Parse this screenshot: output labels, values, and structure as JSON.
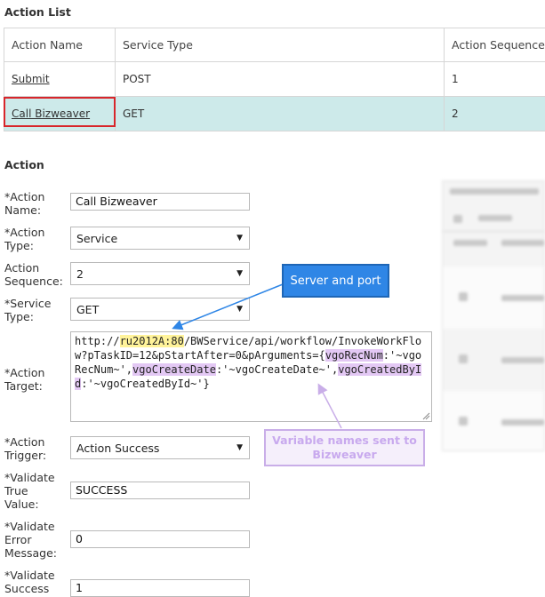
{
  "action_list": {
    "title": "Action List",
    "columns": [
      "Action Name",
      "Service Type",
      "Action Sequence"
    ],
    "rows": [
      {
        "name": "Submit",
        "service_type": "POST",
        "sequence": "1"
      },
      {
        "name": "Call Bizweaver",
        "service_type": "GET",
        "sequence": "2"
      }
    ]
  },
  "action": {
    "title": "Action",
    "fields": {
      "name": {
        "label_line1": "*Action",
        "label_line2": "Name:",
        "value": "Call Bizweaver"
      },
      "type": {
        "label_line1": "*Action",
        "label_line2": "Type:",
        "value": "Service"
      },
      "sequence": {
        "label_line1": "Action",
        "label_line2": "Sequence:",
        "value": "2"
      },
      "service_type": {
        "label_line1": "*Service",
        "label_line2": "Type:",
        "value": "GET"
      },
      "target": {
        "label_line1": "*Action",
        "label_line2": "Target:",
        "parts": {
          "prefix": "http://",
          "server_port": "ru2012A:80",
          "path": "/BWService/api/workflow/InvokeWorkFlow?pTaskID=12&pStartAfter=0&pArguments={",
          "var1": "vgoRecNum",
          "mid1": ":'~vgoRecNum~',",
          "var2": "vgoCreateDate",
          "mid2": ":'~vgoCreateDate~',",
          "var3": "vgoCreatedById",
          "suffix": ":'~vgoCreatedById~'}"
        }
      },
      "trigger": {
        "label_line1": "*Action",
        "label_line2": "Trigger:",
        "value": "Action Success"
      },
      "validate_true": {
        "label_line1": "*Validate",
        "label_line2": "True",
        "label_line3": "Value:",
        "value": "SUCCESS"
      },
      "validate_error": {
        "label_line1": "*Validate",
        "label_line2": "Error",
        "label_line3": "Message:",
        "value": "0"
      },
      "validate_success": {
        "label_line1": "*Validate",
        "label_line2": "Success",
        "value": "1"
      }
    }
  },
  "callouts": {
    "server_port": "Server and port",
    "variables": "Variable names sent to Bizweaver"
  },
  "colors": {
    "selected_row": "#cdeaea",
    "highlight_red": "#d8262b",
    "callout_blue": "#2f86e6",
    "callout_purple_text": "#c8a9ee",
    "server_highlight": "#fff39a",
    "variable_highlight": "#e3c8f4"
  },
  "icons": {
    "dropdown": "caret-down-icon",
    "resize": "resize-grip-icon"
  }
}
